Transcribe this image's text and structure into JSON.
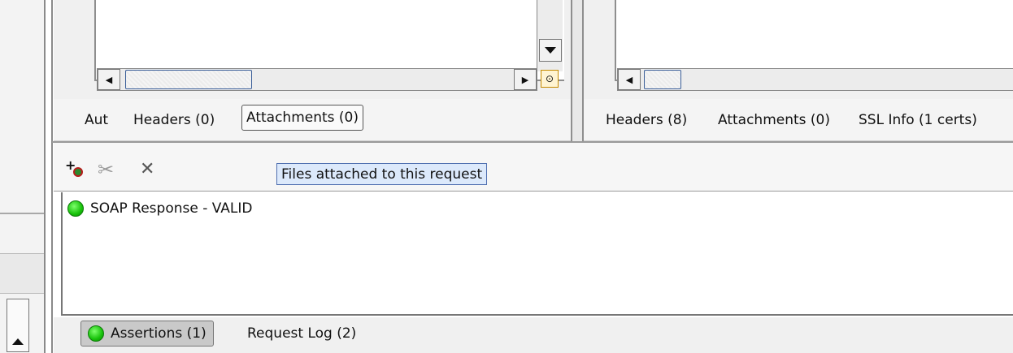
{
  "request_pane": {
    "tabs": [
      {
        "label": "Aut",
        "selected": false
      },
      {
        "label": "Headers (0)",
        "selected": false
      },
      {
        "label": "Attachments (0)",
        "selected": true
      }
    ]
  },
  "response_pane": {
    "tabs": [
      {
        "label": "Headers (8)"
      },
      {
        "label": "Attachments (0)"
      },
      {
        "label": "SSL Info (1 certs)"
      }
    ]
  },
  "toolbar": {
    "add_icon": "add-attachment-icon",
    "edit_icon": "scissors-icon",
    "remove_icon": "close-icon",
    "tooltip": "Files attached to this request"
  },
  "assertions": {
    "items": [
      {
        "label": "SOAP Response - VALID",
        "status_color": "#17c10a"
      }
    ]
  },
  "bottom_tabs": [
    {
      "label": "Assertions (1)",
      "selected": true
    },
    {
      "label": "Request Log (2)",
      "selected": false
    }
  ]
}
